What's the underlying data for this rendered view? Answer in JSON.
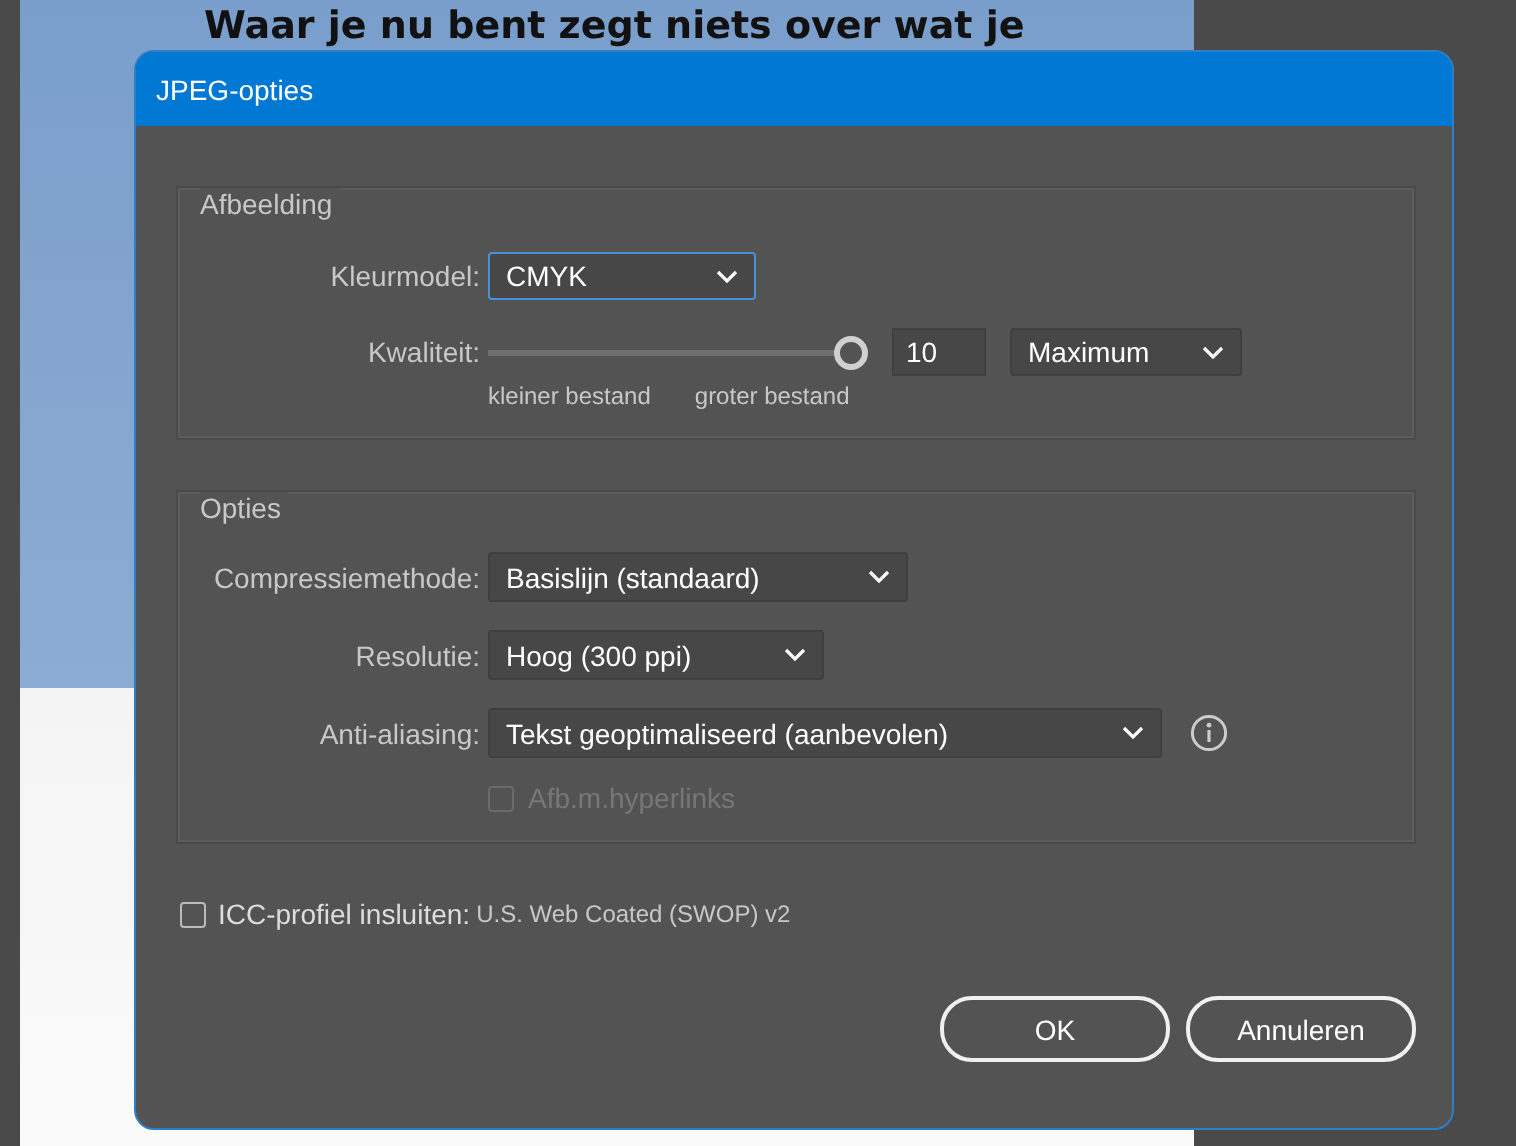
{
  "background_document": {
    "heading": "Waar je nu bent zegt niets over wat je"
  },
  "dialog": {
    "title": "JPEG-opties",
    "image_group": {
      "title": "Afbeelding",
      "color_model": {
        "label": "Kleurmodel:",
        "value": "CMYK",
        "focused": true
      },
      "quality": {
        "label": "Kwaliteit:",
        "level": 1,
        "value": "10",
        "preset": "Maximum",
        "min_label": "kleiner bestand",
        "max_label": "groter bestand"
      }
    },
    "options_group": {
      "title": "Opties",
      "selects": [
        {
          "label": "Compressiemethode:",
          "value": "Basislijn (standaard)"
        },
        {
          "label": "Resolutie:",
          "value": "Hoog (300 ppi)"
        },
        {
          "label": "Anti-aliasing:",
          "value": "Tekst geoptimaliseerd (aanbevolen)"
        }
      ],
      "hyperlinks": {
        "label": "Afb.m.hyperlinks",
        "checked": false,
        "disabled": true
      }
    },
    "icc": {
      "label": "ICC-profiel insluiten:",
      "profile": "U.S. Web Coated (SWOP) v2",
      "checked": false
    },
    "buttons": [
      {
        "label": "OK"
      },
      {
        "label": "Annuleren"
      }
    ]
  }
}
